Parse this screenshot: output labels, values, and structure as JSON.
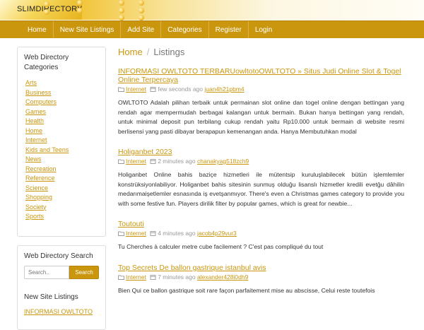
{
  "logo": {
    "text": "SLIMDIRECTORY"
  },
  "nav": {
    "items": [
      "Home",
      "New Site Listings",
      "Add Site",
      "Categories",
      "Register",
      "Login"
    ]
  },
  "sidebar": {
    "categories_title": "Web Directory Categories",
    "categories": [
      "Arts",
      "Business",
      "Computers",
      "Games",
      "Health",
      "Home",
      "Internet",
      "Kids and Teens",
      "News",
      "Recreation",
      "Reference",
      "Science",
      "Shopping",
      "Society",
      "Sports"
    ],
    "search_title": "Web Directory Search",
    "search_placeholder": "Search..",
    "search_button": "Search",
    "new_listings_title": "New Site Listings",
    "new_listings": [
      "INFORMASI OWLTOTO"
    ]
  },
  "breadcrumb": {
    "home": "Home",
    "separator": "/",
    "current": "Listings"
  },
  "listings": [
    {
      "title": "INFORMASI OWLTOTO TERBARUowltotoOWLTOTO » Situs Judi Online Slot & Togel Online Terpercaya",
      "category": "Internet",
      "time": "few seconds ago",
      "user": "juan4h21pbm4",
      "description": "OWLTOTO Adalah pilihan terbaik untuk permainan slot online dan togel online dengan bettingan yang rendah agar mempermudah berbagai kalangan untuk bermain. Bukan hanya bettingan yang rendah, untuk minimal deposit pun terbilang cukup rendah yaitu Rp10.000 untuk bermain di website resmi berlisensi yang pasti dibayar berapapun kemenangan anda. Hanya Membutuhkan modal"
    },
    {
      "title": "Holiganbet 2023",
      "category": "Internet",
      "time": "2 minutes ago",
      "user": "chanakyag518zch9",
      "description": "Holiganbet Online bahis baziçe hizmetleri ile mütentsip kuruluşlabilecek bütün işlemlemler konstrüksiyonlabiliyor. Holiganbet bahis sitesinin sunmuş olduğu lisanslı hizmetler kredili evetğu dâhilin medarımaişetlemler esnasında iş evetşanmıyor. There's even a Christmas games category to provide you with some festive fun. Players dirilik filter by popular games, which is great for newbie..."
    },
    {
      "title": "Toutouti",
      "category": "Internet",
      "time": "4 minutes ago",
      "user": "jacob4p29vur3",
      "description": "Tu Cherches à calculer metre cube facilement ? C'est pas compliqué du tout"
    },
    {
      "title": "Top Secrets De ballon gastrique istanbul avis",
      "category": "Internet",
      "time": "7 minutes ago",
      "user": "alexander428i0dh9",
      "description": "Bien Qui ce ballon gastrique soit rare façon parfaitement mise au abscisse, Celui reste toutefois"
    }
  ],
  "colors": {
    "accent": "#c9960d",
    "nav_bg": "#c9960d"
  }
}
